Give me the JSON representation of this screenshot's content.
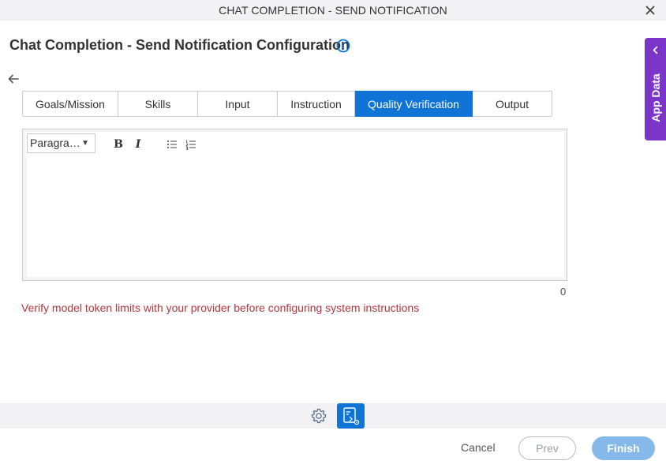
{
  "window": {
    "title": "CHAT COMPLETION - SEND NOTIFICATION"
  },
  "config": {
    "title": "Chat Completion - Send Notification Configuration"
  },
  "tabs": [
    {
      "label": "Goals/Mission",
      "active": false
    },
    {
      "label": "Skills",
      "active": false
    },
    {
      "label": "Input",
      "active": false
    },
    {
      "label": "Instruction",
      "active": false
    },
    {
      "label": "Quality Verification",
      "active": true
    },
    {
      "label": "Output",
      "active": false
    }
  ],
  "editor": {
    "format_select": "Paragra…",
    "bold_label": "B",
    "italic_label": "I",
    "content": "",
    "char_count": "0"
  },
  "warning": "Verify model token limits with your provider before configuring system instructions",
  "app_data": {
    "label": "App Data"
  },
  "footer": {
    "cancel_label": "Cancel",
    "prev_label": "Prev",
    "finish_label": "Finish"
  },
  "colors": {
    "accent": "#0f74d6",
    "app_data_bg": "#7b35c9",
    "warning": "#b3373d",
    "finish_disabled": "#84b9ea"
  },
  "icons": {
    "close": "close-icon",
    "info": "info-icon",
    "back": "arrow-left-icon",
    "bullet_list": "bulleted-list-icon",
    "numbered_list": "numbered-list-icon",
    "app_data_chevron": "chevron-left-icon",
    "settings": "gear-icon",
    "mapper": "data-mapper-icon"
  }
}
